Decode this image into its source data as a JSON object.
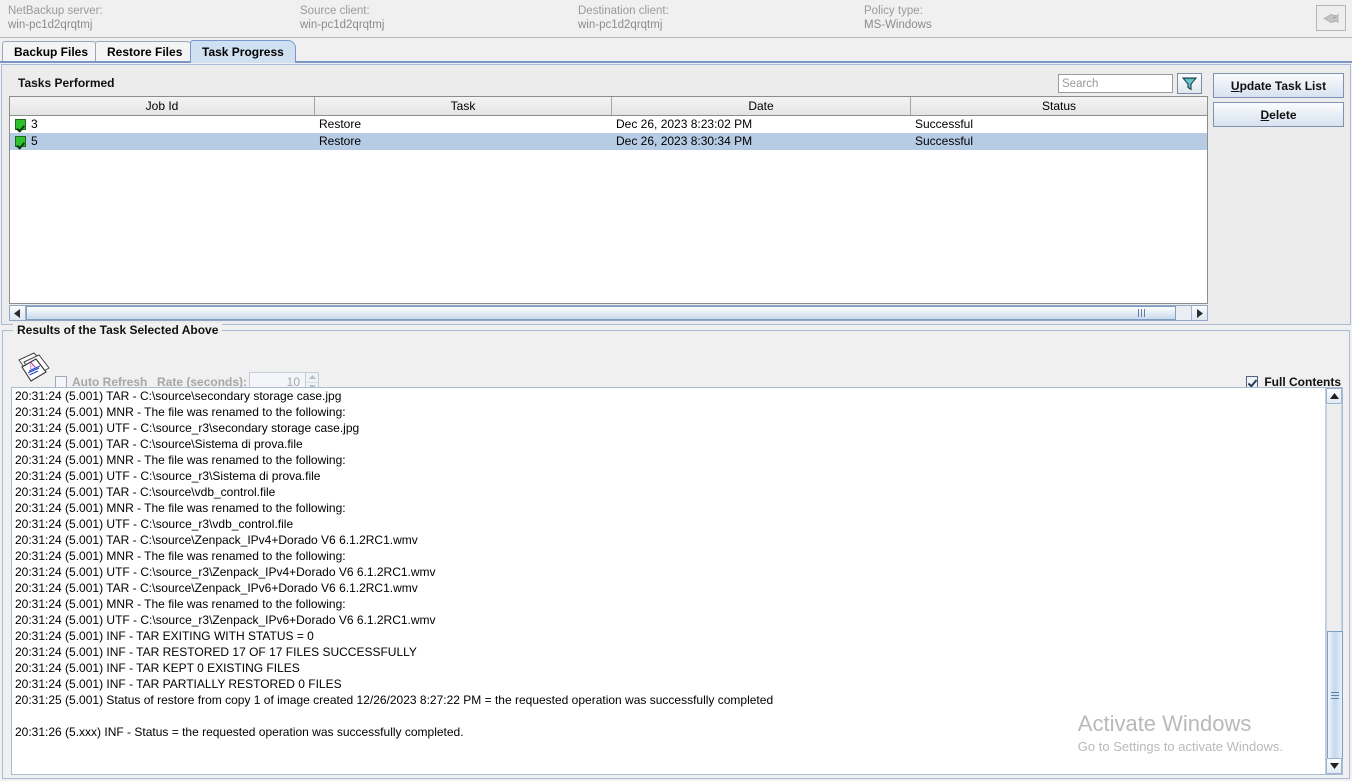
{
  "header": {
    "fields": [
      {
        "label": "NetBackup server:",
        "value": "win-pc1d2qrqtmj"
      },
      {
        "label": "Source client:",
        "value": "win-pc1d2qrqtmj"
      },
      {
        "label": "Destination client:",
        "value": "win-pc1d2qrqtmj"
      },
      {
        "label": "Policy type:",
        "value": "MS-Windows"
      }
    ],
    "corner_icon": "fish-icon"
  },
  "tabs": [
    {
      "label": "Backup Files",
      "active": false
    },
    {
      "label": "Restore Files",
      "active": false
    },
    {
      "label": "Task Progress",
      "active": true
    }
  ],
  "tasks_panel": {
    "title": "Tasks Performed",
    "search": {
      "value": "",
      "placeholder": "Search"
    },
    "filter_icon": "funnel-filter-icon",
    "buttons": [
      {
        "label": "Update Task List",
        "accel": "U"
      },
      {
        "label": "Delete",
        "accel": "D"
      }
    ],
    "columns": [
      "Job Id",
      "Task",
      "Date",
      "Status"
    ],
    "rows": [
      {
        "job_id": "3",
        "task": "Restore",
        "date": "Dec 26, 2023 8:23:02 PM",
        "status": "Successful",
        "selected": false,
        "checked": true
      },
      {
        "job_id": "5",
        "task": "Restore",
        "date": "Dec 26, 2023 8:30:34 PM",
        "status": "Successful",
        "selected": true,
        "checked": true
      }
    ]
  },
  "results_panel": {
    "title": "Results of the Task Selected Above",
    "papers_icon": "documents-icon",
    "auto_refresh_label": "Auto Refresh",
    "auto_refresh_checked": false,
    "rate_label": "Rate (seconds):",
    "rate_value": "10",
    "full_contents_label": "Full Contents",
    "full_contents_checked": true,
    "log_lines": [
      "20:31:24 (5.001) TAR - C:\\source\\secondary storage case.jpg",
      "20:31:24 (5.001) MNR - The file was renamed to the following:",
      "20:31:24 (5.001) UTF - C:\\source_r3\\secondary storage case.jpg",
      "20:31:24 (5.001) TAR - C:\\source\\Sistema di prova.file",
      "20:31:24 (5.001) MNR - The file was renamed to the following:",
      "20:31:24 (5.001) UTF - C:\\source_r3\\Sistema di prova.file",
      "20:31:24 (5.001) TAR - C:\\source\\vdb_control.file",
      "20:31:24 (5.001) MNR - The file was renamed to the following:",
      "20:31:24 (5.001) UTF - C:\\source_r3\\vdb_control.file",
      "20:31:24 (5.001) TAR - C:\\source\\Zenpack_IPv4+Dorado V6 6.1.2RC1.wmv",
      "20:31:24 (5.001) MNR - The file was renamed to the following:",
      "20:31:24 (5.001) UTF - C:\\source_r3\\Zenpack_IPv4+Dorado V6 6.1.2RC1.wmv",
      "20:31:24 (5.001) TAR - C:\\source\\Zenpack_IPv6+Dorado V6 6.1.2RC1.wmv",
      "20:31:24 (5.001) MNR - The file was renamed to the following:",
      "20:31:24 (5.001) UTF - C:\\source_r3\\Zenpack_IPv6+Dorado V6 6.1.2RC1.wmv",
      "20:31:24 (5.001) INF - TAR EXITING WITH STATUS = 0",
      "20:31:24 (5.001) INF - TAR RESTORED 17 OF 17 FILES SUCCESSFULLY",
      "20:31:24 (5.001) INF - TAR KEPT 0 EXISTING FILES",
      "20:31:24 (5.001) INF - TAR PARTIALLY RESTORED 0 FILES",
      "20:31:25 (5.001) Status of restore from copy 1 of image created 12/26/2023 8:27:22 PM = the requested operation was successfully completed",
      "",
      "20:31:26 (5.xxx) INF - Status = the requested operation was successfully completed."
    ]
  },
  "watermark": {
    "line1": "Activate Windows",
    "line2": "Go to Settings to activate Windows."
  }
}
